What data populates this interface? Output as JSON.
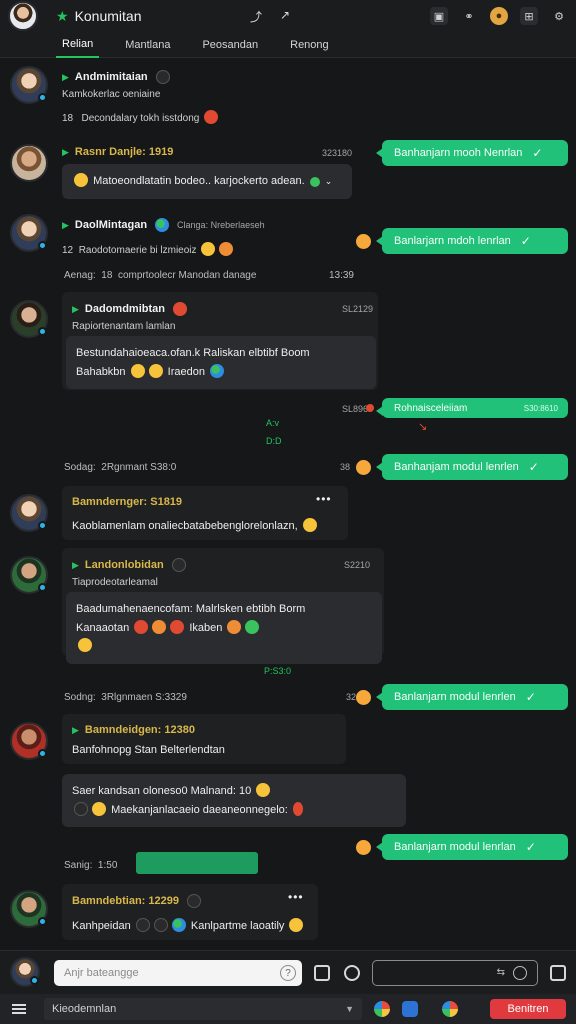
{
  "header": {
    "title": "Konumitan",
    "icons": [
      "avatar",
      "star-icon",
      "phone-icon",
      "arrow-icon",
      "photo-icon",
      "link-icon",
      "coin-icon",
      "cast-icon",
      "settings-icon"
    ]
  },
  "tabs": [
    "Relian",
    "Mantlana",
    "Peosandan",
    "Renong"
  ],
  "messages": {
    "m1": {
      "name": "Andmimitaian",
      "line": "Kamkokerlac oeniaine",
      "meta_count": "18",
      "meta_text": "Decondalary tokh isstdong"
    },
    "m2": {
      "name": "Rasnr Danjle: 1919",
      "time": "323180",
      "text": "Matoeondlatatin bodeo.. karjockerto adean."
    },
    "m3": {
      "name": "DaolMintagan",
      "extra": "Clanga: Nreberlaeseh",
      "meta_count": "12",
      "meta_text": "Raodotomaerie bi lzmieoiz"
    },
    "sys1": {
      "left": "Aenag:",
      "count": "18",
      "text": "comprtoolecr Manodan danage",
      "time": "13:39"
    },
    "m4": {
      "name": "Dadomdmibtan",
      "time": "SL2129",
      "line": "Rapiortenantam lamlan",
      "body1": "Bestundahaioeaca.ofan.k Raliskan elbtibf Boom",
      "body2": "Bahabkbn",
      "body3": "Iraedon"
    },
    "sent_small": {
      "time": "SL896",
      "text": "Rohnaisceleiiam",
      "stamp": "S30:8610"
    },
    "mid_tag1": "A:v",
    "mid_tag2": "D:D",
    "sys2": {
      "left": "Sodag:",
      "text": "2Rgnmant S38:0",
      "time": "38"
    },
    "m5": {
      "name": "Bamndernger: S1819",
      "text": "Kaoblamenlam onaliecbatabebenglorelonlazn,"
    },
    "m6": {
      "name": "Landonlobidan",
      "time": "S2210",
      "line": "Tiaprodeotarleamal",
      "body1": "Baadumahenaencofam: Malrlsken ebtibh Borm",
      "body2": "Kanaaotan",
      "body3": "Ikaben"
    },
    "mid_tag3": "P:S3:0",
    "sys3": {
      "left": "Sodng:",
      "text": "3Rlgnmaen S:3329",
      "time": "32"
    },
    "m7": {
      "name": "Bamndeidgen: 12380",
      "line": "Banfohnopg Stan Belterlendtan",
      "body1": "Saer kandsan oloneso0 Malnand: 10",
      "body2": "Maekanjanlacaeio daeaneonnegelo:"
    },
    "sys4": {
      "left": "Sanig:",
      "count": "1:50"
    },
    "m8": {
      "name": "Bamndebtian: 12299",
      "text": "Kanhpeidan",
      "text2": "Kanlpartme laoatily"
    }
  },
  "sent": {
    "text": "Banhanjarn mooh Nenrlan",
    "text2": "Banlarjarn mdoh lenrlan",
    "text3": "Banhanjam modul lenrlen",
    "text4": "Banlanjarn modul lenrlen",
    "text5": "Banlanjarn modul lenrlan"
  },
  "composer": {
    "placeholder": "Anjr bateangge",
    "help": "?"
  },
  "bottombar": {
    "status": "Kieodemnlan",
    "button": "Benitren"
  },
  "colors": {
    "accent": "#22c55e",
    "sent_bubble": "#22c17a",
    "bg": "#161718",
    "danger": "#e0393e"
  }
}
